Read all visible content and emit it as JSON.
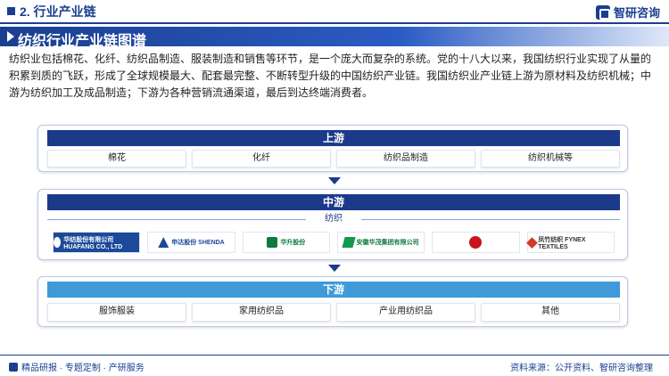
{
  "header": {
    "section_title": "2. 行业产业链",
    "brand_name": "智研咨询"
  },
  "title": "纺织行业产业链图谱",
  "description": "纺织业包括棉花、化纤、纺织品制造、服装制造和销售等环节，是一个庞大而复杂的系统。党的十八大以来，我国纺织行业实现了从量的积累到质的飞跃，形成了全球规模最大、配套最完整、不断转型升级的中国纺织产业链。我国纺织业产业链上游为原材料及纺织机械；中游为纺织加工及成品制造；下游为各种营销流通渠道，最后到达终端消费者。",
  "upstream": {
    "label": "上游",
    "items": [
      "棉花",
      "化纤",
      "纺织品制造",
      "纺织机械等"
    ]
  },
  "midstream": {
    "label": "中游",
    "sub_label": "纺织",
    "logos": [
      {
        "text": "华纺股份有限公司 HUAFANG CO., LTD",
        "icon": "huafang-logo"
      },
      {
        "text": "申达股份 SHENDA",
        "icon": "shenda-logo"
      },
      {
        "text": "华升股份",
        "icon": "huasheng-logo"
      },
      {
        "text": "安徽华茂集团有限公司",
        "icon": "huamao-logo"
      },
      {
        "text": "",
        "icon": "red-seal-logo"
      },
      {
        "text": "凤竹纺织 FYNEX TEXTILES",
        "icon": "fynex-logo"
      }
    ]
  },
  "downstream": {
    "label": "下游",
    "items": [
      "服饰服装",
      "家用纺织品",
      "产业用纺织品",
      "其他"
    ]
  },
  "footer": {
    "left": "精品研报 · 专题定制 · 产研服务",
    "source": "资料来源：公开资料、智研咨询整理"
  },
  "colors": {
    "primary": "#1a3f8f",
    "downstream_header": "#3f9ad8"
  }
}
